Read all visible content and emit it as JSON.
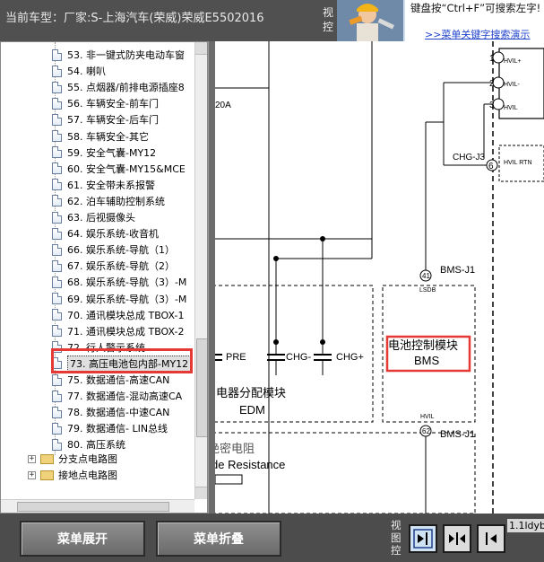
{
  "header": {
    "vehicle_info": "当前车型：厂家:S-上海汽车(荣威)荣威E5502016",
    "view_label": "视控",
    "tip_text": "键盘按“Ctrl+F”可搜索左字!",
    "tip_link": ">>菜单关键字搜索演示"
  },
  "tree": {
    "items": [
      {
        "label": "53. 非一键式防夹电动车窗"
      },
      {
        "label": "54. 喇叭"
      },
      {
        "label": "55. 点烟器/前排电源插座8"
      },
      {
        "label": "56. 车辆安全-前车门"
      },
      {
        "label": "57. 车辆安全-后车门"
      },
      {
        "label": "58. 车辆安全-其它"
      },
      {
        "label": "59. 安全气囊-MY12"
      },
      {
        "label": "60. 安全气囊-MY15&MCE"
      },
      {
        "label": "61. 安全带未系报警"
      },
      {
        "label": "62. 泊车辅助控制系统"
      },
      {
        "label": "63. 后视摄像头"
      },
      {
        "label": "64. 娱乐系统-收音机"
      },
      {
        "label": "66. 娱乐系统-导航（1）"
      },
      {
        "label": "67. 娱乐系统-导航（2）"
      },
      {
        "label": "68. 娱乐系统-导航（3）-M"
      },
      {
        "label": "69. 娱乐系统-导航（3）-M"
      },
      {
        "label": "70. 通讯模块总成 TBOX-1"
      },
      {
        "label": "71. 通讯模块总成 TBOX-2"
      },
      {
        "label": "72. 行人警示系统"
      },
      {
        "label": "73. 高压电池包内部-MY12"
      },
      {
        "label": "75. 数据通信-高速CAN"
      },
      {
        "label": "77. 数据通信-混动高速CA"
      },
      {
        "label": "78. 数据通信-中速CAN"
      },
      {
        "label": "79. 数据通信- LIN总线"
      },
      {
        "label": "80. 高压系统"
      }
    ],
    "selected_index": 19,
    "folders": [
      {
        "label": "分支点电路图",
        "expander": "+"
      },
      {
        "label": "接地点电路图",
        "expander": "+"
      }
    ]
  },
  "diagram": {
    "pins": [
      "1",
      "2",
      "3",
      "6"
    ],
    "pin_labels": [
      "HVIL+",
      "HVIL-",
      "HVIL",
      "HVIL RTN"
    ],
    "connector_chg": "CHG-J3",
    "fuse_label": "20A",
    "bms_top_pin": "41",
    "bms_top_label": "BMS-J1",
    "lsdb": "LSDB",
    "bms_box_cn": "电池控制模块",
    "bms_box_en": "BMS",
    "edm_cn": "电器分配模块",
    "edm_en": "EDM",
    "pre": "PRE",
    "chg_minus": "CHG-",
    "chg_plus": "CHG+",
    "hvil_label": "HVIL",
    "bms_bottom_pin": "62",
    "bms_bottom_label": "BMS-J1",
    "resistance_cn": "绝密电阻",
    "resistance_en": "de Resistance"
  },
  "bottom": {
    "expand_label": "菜单展开",
    "collapse_label": "菜单折叠",
    "view_label": "视图控",
    "version": "1.1ldyb"
  }
}
